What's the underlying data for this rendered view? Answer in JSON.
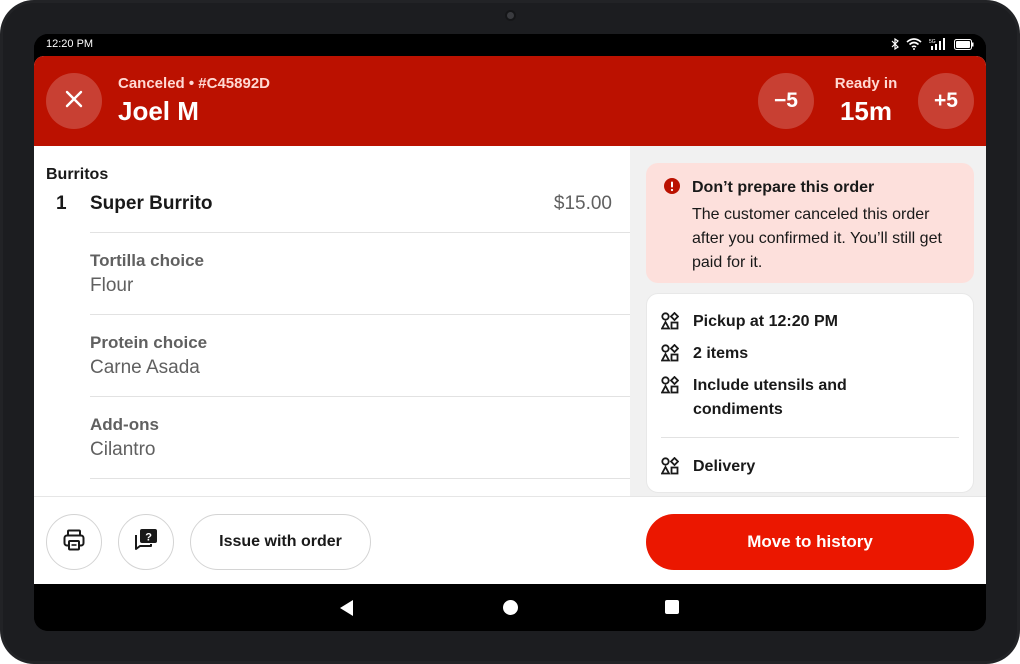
{
  "status_bar": {
    "time": "12:20 PM",
    "icons": [
      "bluetooth-icon",
      "wifi-icon",
      "signal-5g-icon",
      "battery-icon"
    ]
  },
  "header": {
    "status": "Canceled • #C45892D",
    "customer_name": "Joel M",
    "decrease_label": "−5",
    "ready_label": "Ready in",
    "ready_value": "15m",
    "increase_label": "+5",
    "background_color": "#bb1100"
  },
  "order": {
    "category": "Burritos",
    "item": {
      "quantity": "1",
      "name": "Super Burrito",
      "price": "$15.00"
    },
    "options": [
      {
        "label": "Tortilla choice",
        "value": "Flour"
      },
      {
        "label": "Protein choice",
        "value": "Carne Asada"
      },
      {
        "label": "Add-ons",
        "value": "Cilantro"
      }
    ]
  },
  "alert": {
    "title": "Don’t prepare this order",
    "body": "The customer canceled this order after you confirmed it. You’ll still get paid for it.",
    "icon": "error-icon",
    "background_color": "#fde0dc"
  },
  "details": [
    {
      "text": "Pickup at 12:20 PM",
      "icon": "shapes-icon"
    },
    {
      "text": "2 items",
      "icon": "shapes-icon"
    },
    {
      "text": "Include utensils and condiments",
      "icon": "shapes-icon"
    },
    {
      "text": "Delivery",
      "icon": "shapes-icon"
    }
  ],
  "footer": {
    "print_icon": "printer-icon",
    "help_icon": "help-chat-icon",
    "issue_label": "Issue with order",
    "history_label": "Move to history",
    "accent_color": "#eb1700"
  }
}
